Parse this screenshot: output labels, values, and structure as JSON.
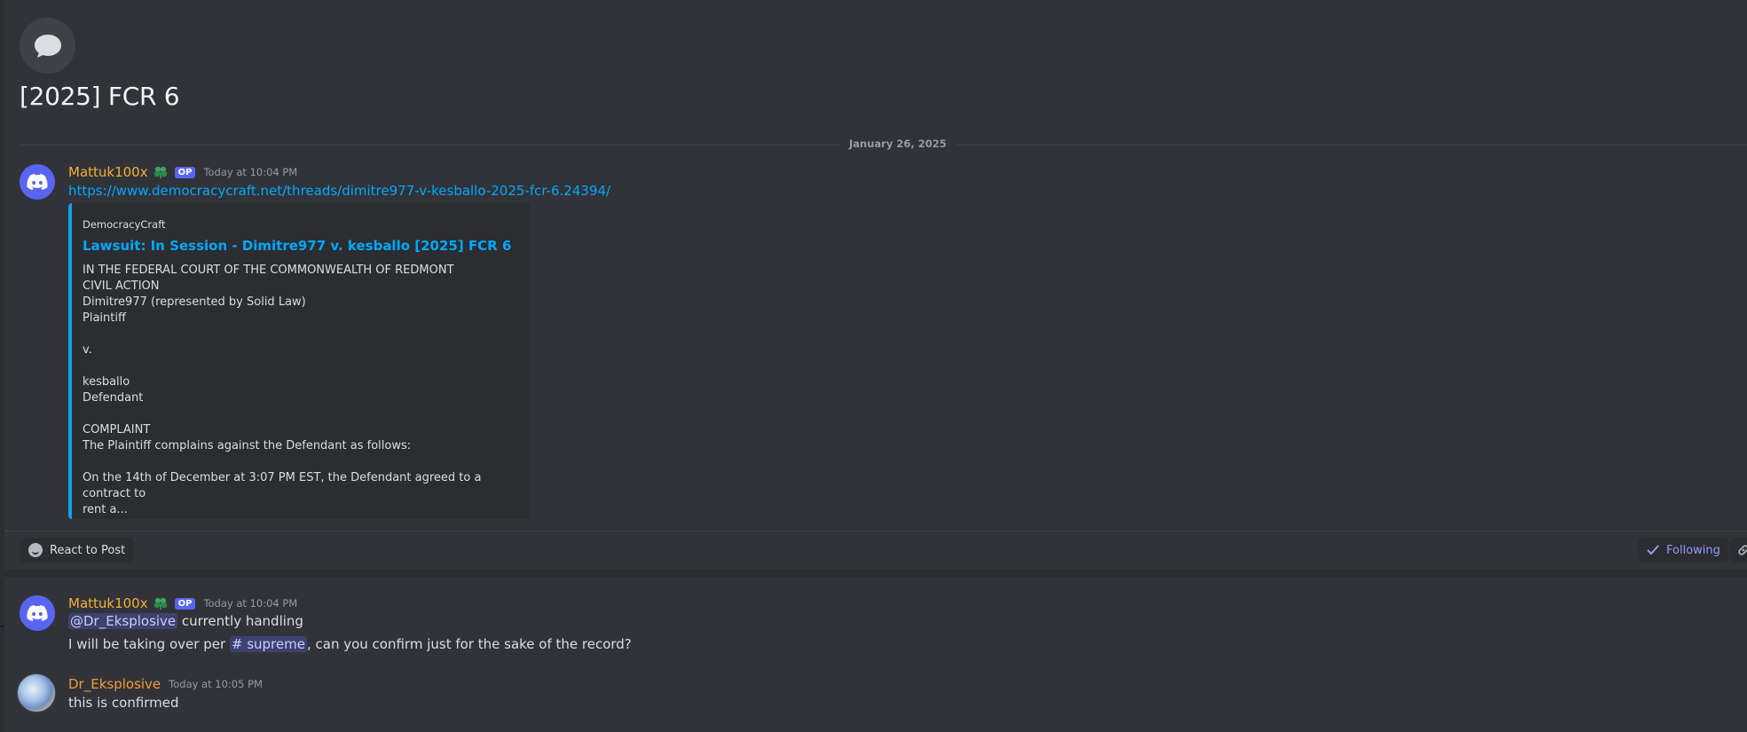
{
  "thread": {
    "title": "[2025] FCR 6",
    "icon": "chat-bubble-icon"
  },
  "date_divider": "January 26, 2025",
  "post": {
    "author": "Mattuk100x",
    "op_badge": "OP",
    "timestamp": "Today at 10:04 PM",
    "link": "https://www.democracycraft.net/threads/dimitre977-v-kesballo-2025-fcr-6.24394/",
    "embed": {
      "provider": "DemocracyCraft",
      "title": "Lawsuit: In Session - Dimitre977 v. kesballo [2025] FCR 6",
      "lines": [
        "IN THE FEDERAL COURT OF THE COMMONWEALTH OF REDMONT",
        "CIVIL ACTION",
        "Dimitre977 (represented by Solid Law)",
        "Plaintiff",
        "",
        "v.",
        "",
        "kesballo",
        "Defendant",
        "",
        "COMPLAINT",
        "The Plaintiff complains against the Defendant as follows:",
        "",
        "On the 14th of December at 3:07 PM EST, the Defendant agreed to a contract to",
        "rent a..."
      ]
    },
    "accent_color": "#0fa0f0"
  },
  "actions": {
    "react_label": "React to Post",
    "following_label": "Following"
  },
  "reply1": {
    "author": "Mattuk100x",
    "op_badge": "OP",
    "timestamp": "Today at 10:04 PM",
    "mention": "@Dr_Eksplosive",
    "line1_rest": " currently handling",
    "line2_before": "I will be taking over per ",
    "channel_mention": "# supreme",
    "line2_after": ", can you confirm just for the sake of the record?"
  },
  "reply2": {
    "author": "Dr_Eksplosive",
    "timestamp": "Today at 10:05 PM",
    "text": "this is confirmed"
  },
  "colors": {
    "background": "#323339",
    "username_op": "#f0b232",
    "username_other": "#f09a32",
    "link": "#00a8fc",
    "brand": "#5865f2"
  }
}
